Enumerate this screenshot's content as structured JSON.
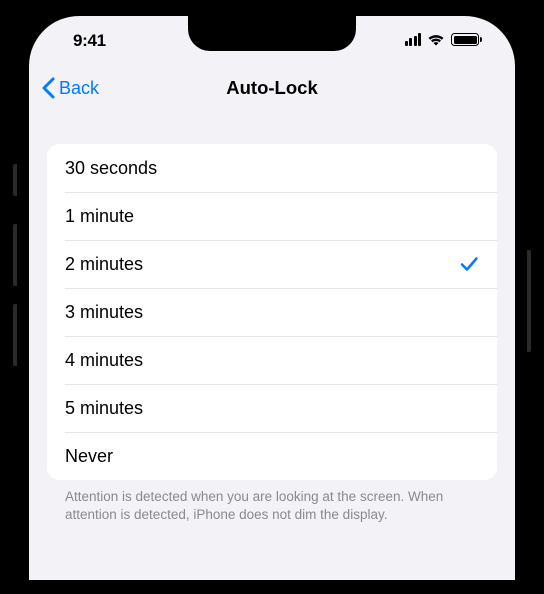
{
  "status": {
    "time": "9:41"
  },
  "nav": {
    "back": "Back",
    "title": "Auto-Lock"
  },
  "options": [
    {
      "label": "30 seconds",
      "selected": false
    },
    {
      "label": "1 minute",
      "selected": false
    },
    {
      "label": "2 minutes",
      "selected": true
    },
    {
      "label": "3 minutes",
      "selected": false
    },
    {
      "label": "4 minutes",
      "selected": false
    },
    {
      "label": "5 minutes",
      "selected": false
    },
    {
      "label": "Never",
      "selected": false
    }
  ],
  "footer": "Attention is detected when you are looking at the screen. When attention is detected, iPhone does not dim the display.",
  "colors": {
    "accent": "#007aff"
  }
}
